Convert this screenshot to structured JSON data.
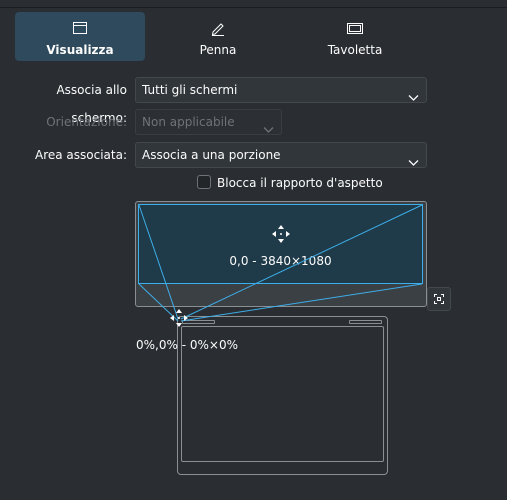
{
  "tabs": [
    {
      "label": "Visualizza",
      "icon": "display-icon",
      "active": true
    },
    {
      "label": "Penna",
      "icon": "pen-icon",
      "active": false
    },
    {
      "label": "Tavoletta",
      "icon": "tablet-icon",
      "active": false
    }
  ],
  "form": {
    "screen_label": "Associa allo schermo:",
    "screen_value": "Tutti gli schermi",
    "orientation_label": "Orientazione:",
    "orientation_value": "Non applicabile",
    "area_label": "Area associata:",
    "area_value": "Associa a una porzione",
    "lock_ratio_label": "Blocca il rapporto d'aspetto",
    "lock_ratio_checked": false
  },
  "preview": {
    "screen_text": "0,0 - 3840×1080",
    "tablet_text": "0%,0% - 0%×0%"
  },
  "colors": {
    "accent": "#3daee9",
    "background": "#2a2e32"
  }
}
